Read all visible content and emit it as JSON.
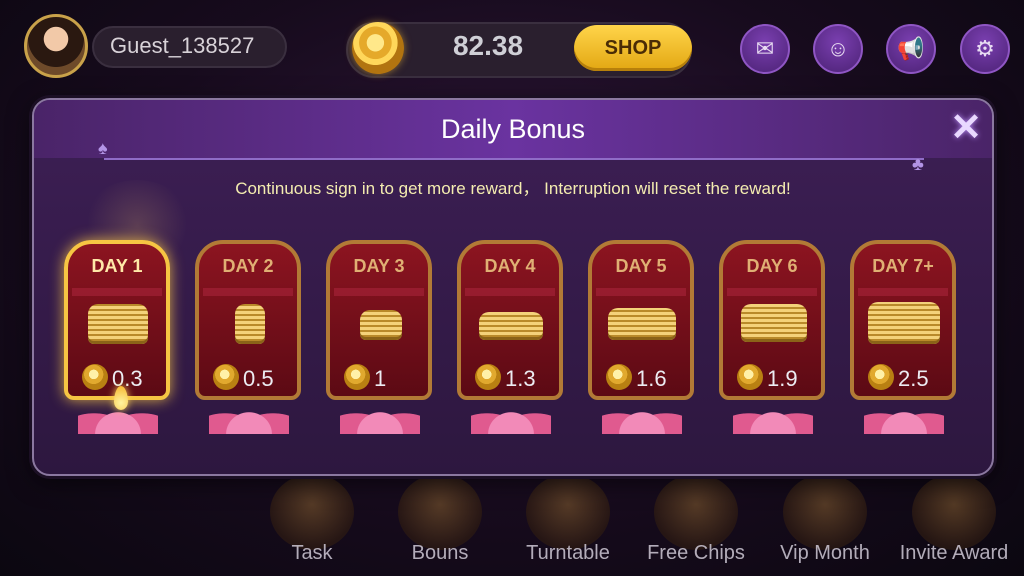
{
  "topbar": {
    "username": "Guest_138527",
    "balance": "82.38",
    "shop_label": "SHOP",
    "icons": [
      "mail-icon",
      "support-icon",
      "megaphone-icon",
      "gear-icon"
    ]
  },
  "dialog": {
    "title": "Daily Bonus",
    "subtitle": "Continuous sign in to get more reward， Interruption will reset the reward!",
    "close_symbol": "✕"
  },
  "days": [
    {
      "label": "DAY 1",
      "amount": "0.3",
      "active": true
    },
    {
      "label": "DAY 2",
      "amount": "0.5",
      "active": false
    },
    {
      "label": "DAY 3",
      "amount": "1",
      "active": false
    },
    {
      "label": "DAY 4",
      "amount": "1.3",
      "active": false
    },
    {
      "label": "DAY 5",
      "amount": "1.6",
      "active": false
    },
    {
      "label": "DAY 6",
      "amount": "1.9",
      "active": false
    },
    {
      "label": "DAY 7+",
      "amount": "2.5",
      "active": false
    }
  ],
  "bottom_menu": [
    {
      "label": "Task"
    },
    {
      "label": "Bouns"
    },
    {
      "label": "Turntable"
    },
    {
      "label": "Free Chips"
    },
    {
      "label": "Vip Month"
    },
    {
      "label": "Invite Award"
    }
  ],
  "colors": {
    "accent_gold": "#f6c543",
    "dialog_purple": "#3d1f55",
    "card_red": "#8c1420"
  }
}
